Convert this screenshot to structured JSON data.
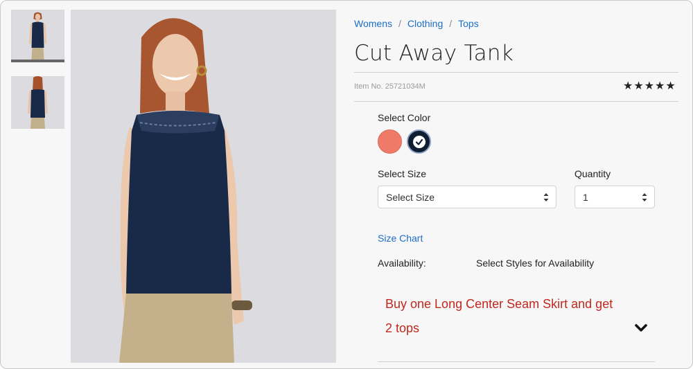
{
  "breadcrumb": [
    {
      "label": "Womens"
    },
    {
      "label": "Clothing"
    },
    {
      "label": "Tops"
    }
  ],
  "breadcrumb_separator": "/",
  "product": {
    "title": "Cut Away Tank",
    "item_no": "Item No. 25721034M",
    "rating_stars": "★★★★★",
    "rating_value": 5
  },
  "color": {
    "label": "Select Color",
    "options": [
      {
        "name": "coral",
        "hex": "#ef7a68",
        "selected": false
      },
      {
        "name": "navy",
        "hex": "#0f1d33",
        "selected": true
      }
    ]
  },
  "size": {
    "label": "Select Size",
    "selected_value": "Select Size"
  },
  "quantity": {
    "label": "Quantity",
    "selected_value": "1"
  },
  "size_chart_link": "Size Chart",
  "availability": {
    "label": "Availability:",
    "value": "Select Styles for Availability"
  },
  "promo": {
    "text": "Buy one Long Center Seam Skirt and get 2 tops",
    "color": "#c0281e"
  },
  "icons": {
    "expand": "chevron-down-icon",
    "selected_check": "check-icon",
    "select_arrows": "select-arrows-icon"
  },
  "colors": {
    "link": "#1a6fc9",
    "promo": "#c0281e"
  }
}
